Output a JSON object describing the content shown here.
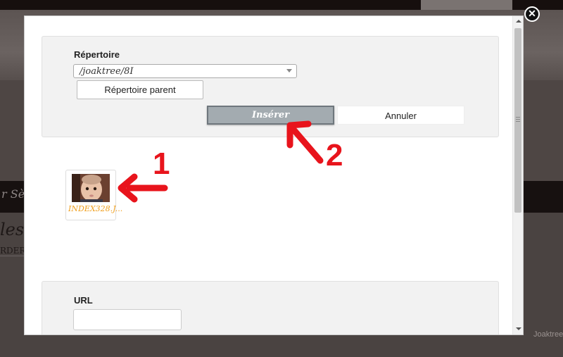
{
  "background": {
    "band_text": "r Sèv",
    "lower_title": "les",
    "lower_text": "RDER",
    "footer_text": "Joaktree"
  },
  "dialog": {
    "directory_label": "Répertoire",
    "directory_value": "/joaktree/8I",
    "parent_button": "Répertoire parent",
    "insert_button": "Insérer",
    "cancel_button": "Annuler",
    "file": {
      "caption": "INDEX328.J..."
    },
    "url_label": "URL",
    "url_value": "",
    "close_glyph": "✕"
  },
  "annotations": {
    "marker_1": "1",
    "marker_2": "2",
    "color": "#e8141c"
  }
}
